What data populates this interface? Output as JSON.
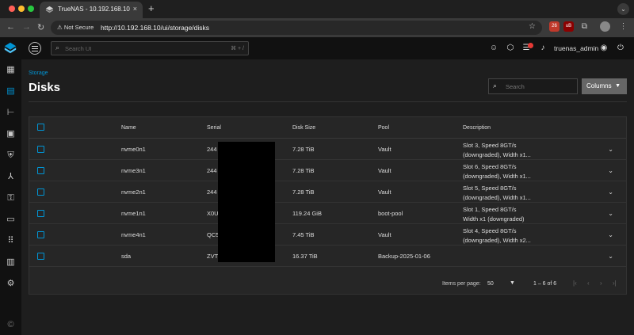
{
  "browser": {
    "tab_title": "TrueNAS - 10.192.168.10",
    "tab_close": "×",
    "new_tab": "+",
    "security_label": "Not Secure",
    "url": "http://10.192.168.10/ui/storage/disks",
    "ext_badge_1": "26",
    "ext_badge_2": "uB"
  },
  "topbar": {
    "search_placeholder": "Search UI",
    "search_shortcut": "⌘ + /",
    "username": "truenas_admin"
  },
  "sidebar": {
    "items": [
      "dashboard-icon",
      "storage-icon",
      "datasets-icon",
      "shares-icon",
      "data-protection-icon",
      "network-icon",
      "credentials-icon",
      "virtualization-icon",
      "apps-icon",
      "reporting-icon",
      "system-icon"
    ],
    "active": "storage-icon"
  },
  "page": {
    "breadcrumb": "Storage",
    "title": "Disks",
    "search_placeholder": "Search",
    "columns_button": "Columns"
  },
  "table": {
    "headers": {
      "name": "Name",
      "serial": "Serial",
      "size": "Disk Size",
      "pool": "Pool",
      "description": "Description"
    },
    "rows": [
      {
        "name": "nvme0n1",
        "serial": "244",
        "size": "7.28 TiB",
        "pool": "Vault",
        "desc1": "Slot 3, Speed 8GT/s",
        "desc2": "(downgraded), Width x1..."
      },
      {
        "name": "nvme3n1",
        "serial": "244",
        "size": "7.28 TiB",
        "pool": "Vault",
        "desc1": "Slot 6, Speed 8GT/s",
        "desc2": "(downgraded), Width x1..."
      },
      {
        "name": "nvme2n1",
        "serial": "244",
        "size": "7.28 TiB",
        "pool": "Vault",
        "desc1": "Slot 5, Speed 8GT/s",
        "desc2": "(downgraded), Width x1..."
      },
      {
        "name": "nvme1n1",
        "serial": "X0U",
        "size": "119.24 GiB",
        "pool": "boot-pool",
        "desc1": "Slot 1, Speed 8GT/s",
        "desc2": "Width x1 (downgraded)"
      },
      {
        "name": "nvme4n1",
        "serial": "QC5",
        "size": "7.45 TiB",
        "pool": "Vault",
        "desc1": "Slot 4, Speed 8GT/s",
        "desc2": "(downgraded), Width x2..."
      },
      {
        "name": "sda",
        "serial": "ZVT",
        "size": "16.37 TiB",
        "pool": "Backup-2025-01-06",
        "desc1": "",
        "desc2": ""
      }
    ]
  },
  "pager": {
    "items_label": "Items per page:",
    "page_size": "50",
    "range": "1 – 6 of 6"
  },
  "colors": {
    "accent": "#0095d5",
    "background": "#1e1e1e",
    "card": "#262626"
  }
}
